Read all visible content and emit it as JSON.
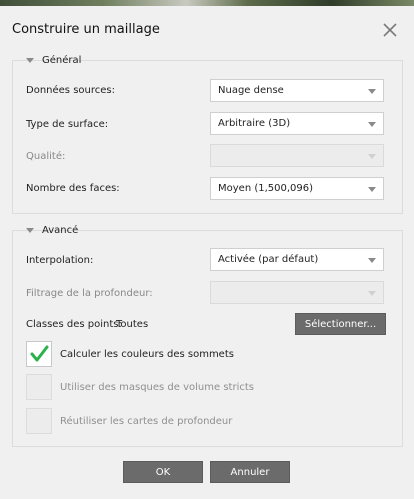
{
  "dialog": {
    "title": "Construire un maillage"
  },
  "general": {
    "title": "Général",
    "source_data": {
      "label": "Données sources:",
      "value": "Nuage dense"
    },
    "surface_type": {
      "label": "Type de surface:",
      "value": "Arbitraire (3D)"
    },
    "quality": {
      "label": "Qualité:",
      "value": ""
    },
    "face_count": {
      "label": "Nombre des faces:",
      "value": "Moyen (1,500,096)"
    }
  },
  "advanced": {
    "title": "Avancé",
    "interpolation": {
      "label": "Interpolation:",
      "value": "Activée (par défaut)"
    },
    "depth_filtering": {
      "label": "Filtrage de la profondeur:",
      "value": ""
    },
    "point_classes": {
      "label": "Classes des points:",
      "value": "Toutes"
    },
    "select_button": "Sélectionner...",
    "checkboxes": [
      {
        "label": "Calculer les couleurs des sommets",
        "checked": true,
        "enabled": true
      },
      {
        "label": "Utiliser des masques de volume stricts",
        "checked": false,
        "enabled": false
      },
      {
        "label": "Réutiliser les cartes de profondeur",
        "checked": false,
        "enabled": false
      }
    ]
  },
  "footer": {
    "ok": "OK",
    "cancel": "Annuler"
  },
  "colors": {
    "accent_check": "#2bb24c",
    "button_bg": "#6b6b6b",
    "dialog_bg": "#f0f0f0"
  }
}
